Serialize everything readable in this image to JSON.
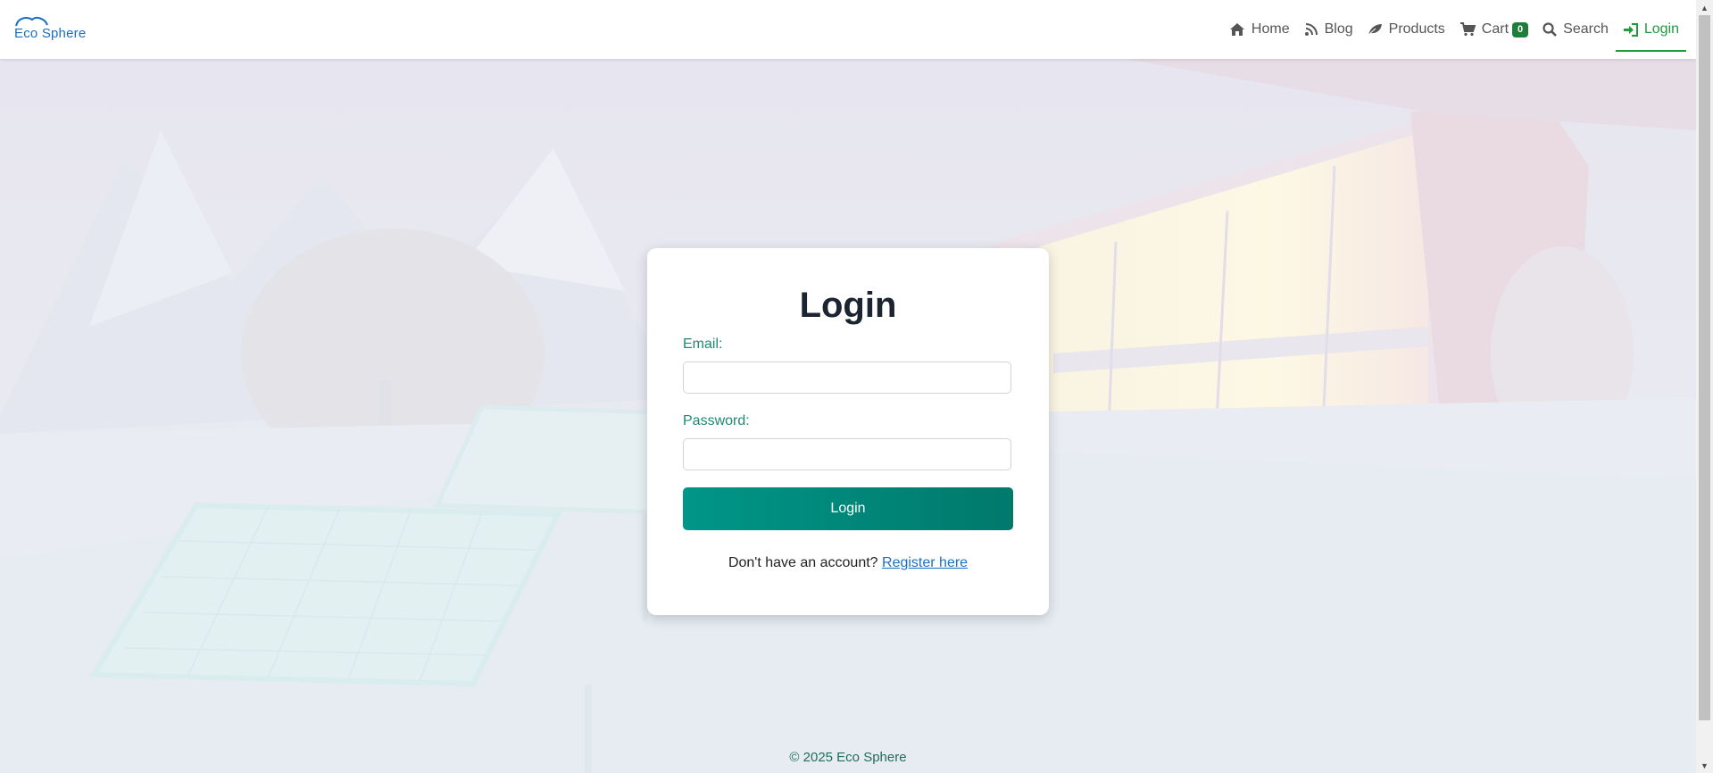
{
  "brand": {
    "name": "Eco Sphere",
    "color": "#1a6fc4"
  },
  "nav": {
    "items": [
      {
        "label": "Home",
        "icon": "home-icon"
      },
      {
        "label": "Blog",
        "icon": "blog-icon"
      },
      {
        "label": "Products",
        "icon": "leaf-icon"
      },
      {
        "label": "Cart",
        "icon": "cart-icon",
        "badge": "0"
      },
      {
        "label": "Search",
        "icon": "search-icon"
      },
      {
        "label": "Login",
        "icon": "sign-in-icon",
        "active": true
      }
    ],
    "active_color": "#1e9c3c"
  },
  "login": {
    "title": "Login",
    "email_label": "Email:",
    "email_value": "",
    "password_label": "Password:",
    "password_value": "",
    "submit_label": "Login",
    "register_prompt": "Don't have an account?",
    "register_link": "Register here",
    "button_color": "#00897b"
  },
  "footer": {
    "text": "© 2025 Eco Sphere"
  }
}
